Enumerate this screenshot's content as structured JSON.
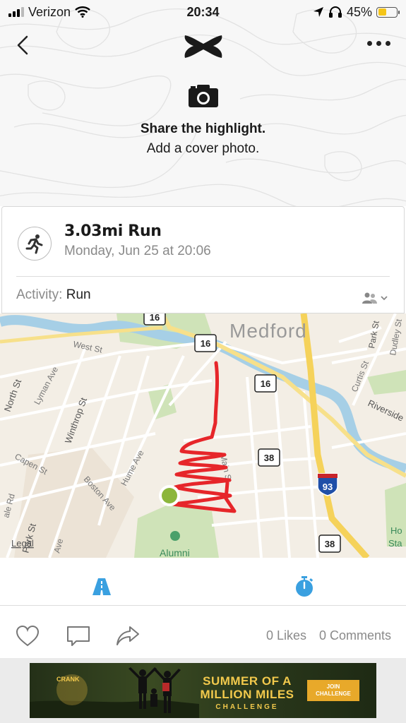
{
  "status_bar": {
    "carrier": "Verizon",
    "time": "20:34",
    "battery": "45%",
    "battery_level": 0.45
  },
  "header": {
    "share_title": "Share the highlight.",
    "share_subtitle": "Add a cover photo."
  },
  "workout": {
    "title": "3.03mi Run",
    "date": "Monday, Jun 25 at 20:06",
    "activity_label": "Activity:",
    "activity_value": "Run"
  },
  "map": {
    "city_label": "Medford",
    "streets": [
      "West St",
      "Lyman Ave",
      "North St",
      "Winthrop St",
      "Capen St",
      "Boston Ave",
      "Hume Ave",
      "Main St",
      "Park St",
      "Dudley St",
      "Riverside",
      "Curtis St",
      "Park St",
      "Ho",
      "Sta",
      "ale Rd",
      "Ave",
      "Alumni"
    ],
    "route_shields": [
      "16",
      "16",
      "16",
      "38",
      "38"
    ],
    "interstate_shield": "93",
    "legal_label": "Legal",
    "route_color": "#e6262a",
    "start_marker_color": "#8cb63c"
  },
  "social": {
    "likes": "0 Likes",
    "comments": "0 Comments"
  },
  "ad": {
    "headline_line1": "SUMMER OF A",
    "headline_line2": "MILLION MILES",
    "tagline": "CHALLENGE",
    "button_line1": "JOIN",
    "button_line2": "CHALLENGE",
    "brand": "CRANK"
  },
  "colors": {
    "accent": "#3aa0e0",
    "route": "#e6262a",
    "highway": "#f5d25a"
  }
}
